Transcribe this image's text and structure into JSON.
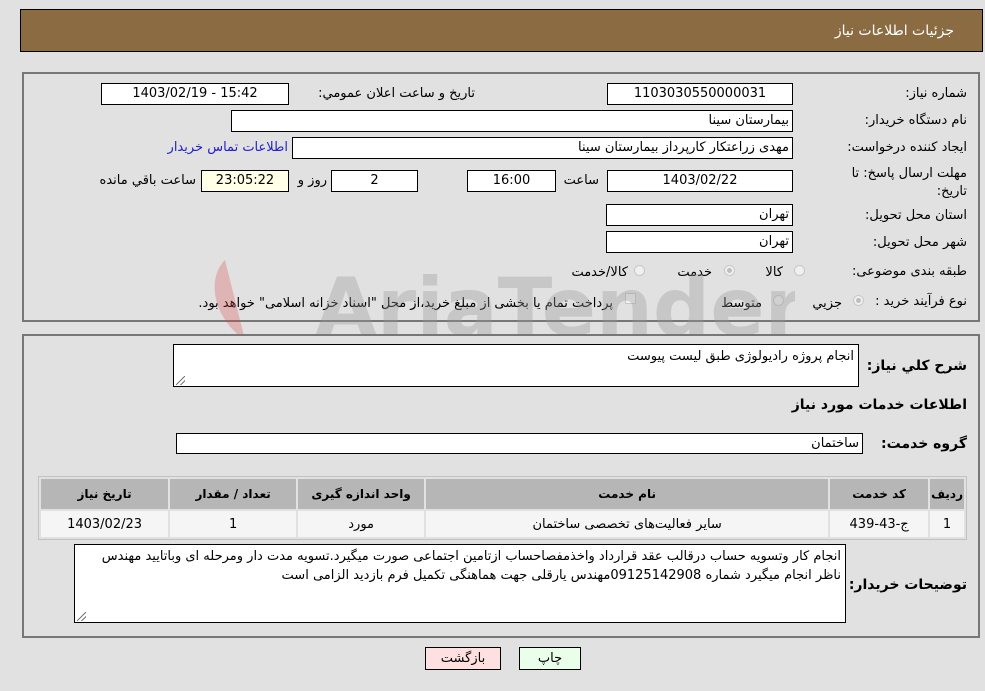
{
  "header": {
    "title": "جزئیات اطلاعات نیاز"
  },
  "form": {
    "need_number_label": "شماره نیاز:",
    "need_number": "1103030550000031",
    "announce_label": "تاریخ و ساعت اعلان عمومي:",
    "announce_value": "1403/02/19 - 15:42",
    "buyer_org_label": "نام دستگاه خریدار:",
    "buyer_org": "بیمارستان سینا",
    "creator_label": "ایجاد کننده درخواست:",
    "creator": "مهدی  زراعتکار  کارپرداز بیمارستان سینا",
    "contact_link": "اطلاعات تماس خریدار",
    "deadline_label": "مهلت ارسال پاسخ: تا تاریخ:",
    "deadline_date": "1403/02/22",
    "time_label": "ساعت",
    "deadline_time": "16:00",
    "days_value": "2",
    "days_label": "روز و",
    "remaining_time": "23:05:22",
    "remaining_label": "ساعت باقي مانده",
    "province_label": "استان محل تحویل:",
    "province": "تهران",
    "city_label": "شهر محل تحویل:",
    "city": "تهران",
    "category_label": "طبقه بندی موضوعی:",
    "category_options": [
      {
        "label": "کالا",
        "selected": false
      },
      {
        "label": "خدمت",
        "selected": true
      },
      {
        "label": "کالا/خدمت",
        "selected": false
      }
    ],
    "process_label": "نوع فرآیند خرید :",
    "process_options": [
      {
        "label": "جزيي",
        "selected": true
      },
      {
        "label": "متوسط",
        "selected": false
      }
    ],
    "treasury_note": "پرداخت تمام یا بخشی از مبلغ خرید،از محل \"اسناد خزانه اسلامی\" خواهد بود.",
    "treasury_checked": false
  },
  "details": {
    "summary_label": "شرح کلي نیاز:",
    "summary": "انجام پروژه رادیولوژی طبق لیست پیوست",
    "services_title": "اطلاعات خدمات مورد نیاز",
    "service_group_label": "گروه خدمت:",
    "service_group": "ساختمان",
    "table": {
      "headers": [
        "ردیف",
        "کد خدمت",
        "نام خدمت",
        "واحد اندازه گیری",
        "تعداد / مقدار",
        "تاریخ نیاز"
      ],
      "rows": [
        [
          "1",
          "ج-43-439",
          "سایر فعالیت‌های تخصصی ساختمان",
          "مورد",
          "1",
          "1403/02/23"
        ]
      ]
    },
    "buyer_notes_label": "توضیحات خریدار:",
    "buyer_notes": "انجام کار وتسویه حساب درقالب عقد قرارداد واخذمفصاحساب ازتامین اجتماعی صورت میگیرد.تسویه مدت دار ومرحله ای وباتایید مهندس ناظر انجام میگیرد شماره 09125142908مهندس یارقلی جهت هماهنگی تکمیل فرم بازدید الزامی است"
  },
  "buttons": {
    "print": "چاپ",
    "back": "بازگشت"
  },
  "watermark": {
    "text": "AriaTender.neT"
  }
}
